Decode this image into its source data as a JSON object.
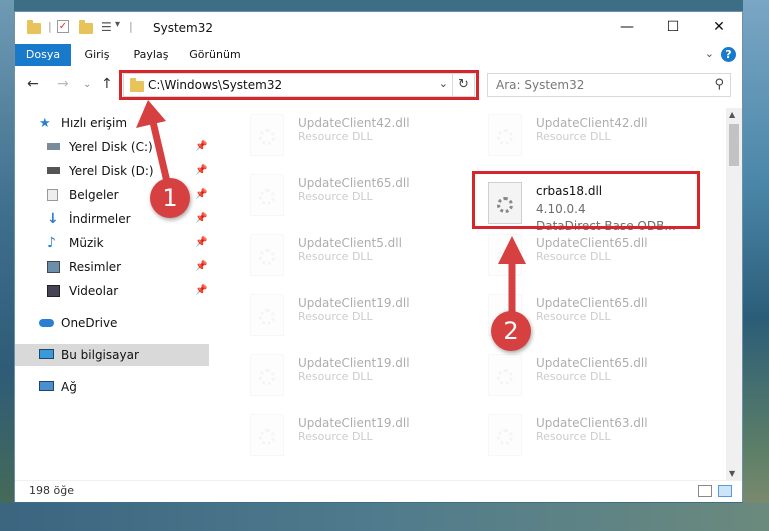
{
  "window": {
    "title": "System32"
  },
  "title_controls": {
    "minimize": "—",
    "maximize": "☐",
    "close": "✕"
  },
  "ribbon": {
    "tabs": [
      {
        "label": "Dosya",
        "active": true
      },
      {
        "label": "Giriş"
      },
      {
        "label": "Paylaş"
      },
      {
        "label": "Görünüm"
      }
    ],
    "help": "?"
  },
  "address": {
    "path": "C:\\Windows\\System32"
  },
  "search": {
    "placeholder": "Ara: System32"
  },
  "nav": {
    "items": [
      {
        "label": "Hızlı erişim",
        "icon": "star-icon"
      },
      {
        "label": "Yerel Disk (C:)",
        "icon": "drive-icon",
        "pinned": true
      },
      {
        "label": "Yerel Disk (D:)",
        "icon": "drive-icon",
        "pinned": true
      },
      {
        "label": "Belgeler",
        "icon": "documents-icon",
        "pinned": true
      },
      {
        "label": "İndirmeler",
        "icon": "download-icon",
        "pinned": true
      },
      {
        "label": "Müzik",
        "icon": "music-icon",
        "pinned": true
      },
      {
        "label": "Resimler",
        "icon": "pictures-icon",
        "pinned": true
      },
      {
        "label": "Videolar",
        "icon": "videos-icon",
        "pinned": true
      },
      {
        "label": "OneDrive",
        "icon": "cloud-icon"
      },
      {
        "label": "Bu bilgisayar",
        "icon": "computer-icon",
        "selected": true
      },
      {
        "label": "Ağ",
        "icon": "network-icon"
      }
    ]
  },
  "files": {
    "left": [
      {
        "name": "UpdateClient42.dll",
        "type": "Resource DLL"
      },
      {
        "name": "UpdateClient65.dll",
        "type": "Resource DLL"
      },
      {
        "name": "UpdateClient5.dll",
        "type": "Resource DLL"
      },
      {
        "name": "UpdateClient19.dll",
        "type": "Resource DLL"
      },
      {
        "name": "UpdateClient19.dll",
        "type": "Resource DLL"
      },
      {
        "name": "UpdateClient19.dll",
        "type": "Resource DLL"
      }
    ],
    "right": [
      {
        "name": "UpdateClient42.dll",
        "type": "Resource DLL"
      },
      {
        "name": "UpdateClient65.dll",
        "type": "Resource DLL"
      },
      {
        "name": "UpdateClient65.dll",
        "type": "Resource DLL"
      },
      {
        "name": "UpdateClient65.dll",
        "type": "Resource DLL"
      },
      {
        "name": "UpdateClient63.dll",
        "type": "Resource DLL"
      }
    ],
    "highlighted": {
      "name": "crbas18.dll",
      "version": "4.10.0.4",
      "description": "DataDirect Base ODB..."
    }
  },
  "status": {
    "count": "198 öğe"
  },
  "callouts": {
    "first": "1",
    "second": "2"
  },
  "colors": {
    "accent": "#1979ca",
    "highlight_box": "#d6262b",
    "callout": "#d74040"
  }
}
